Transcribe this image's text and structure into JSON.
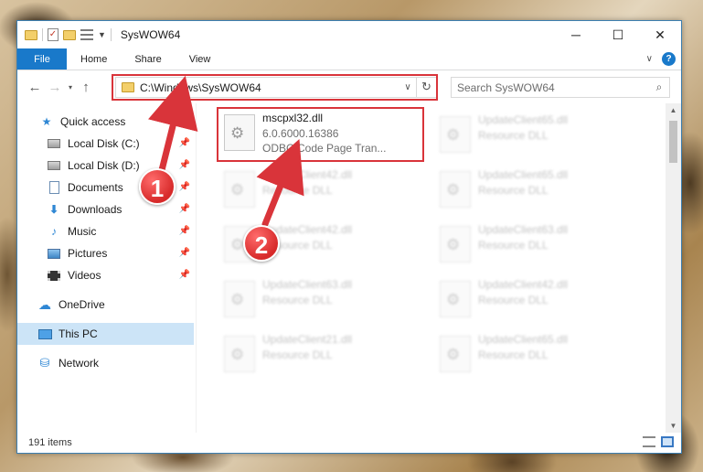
{
  "window": {
    "title": "SysWOW64",
    "controls": {
      "minimize": "─",
      "maximize": "☐",
      "close": "✕"
    }
  },
  "ribbon": {
    "tabs": [
      "File",
      "Home",
      "Share",
      "View"
    ],
    "collapse_glyph": "∨",
    "help_glyph": "?"
  },
  "navbar": {
    "back": "←",
    "forward": "→",
    "recent": "▾",
    "up": "↑",
    "address": "C:\\Windows\\SysWOW64",
    "address_chevron": "∨",
    "refresh": "↻",
    "search_placeholder": "Search SysWOW64",
    "search_glyph": "⌕"
  },
  "sidebar": {
    "items": [
      {
        "label": "Quick access",
        "icon": "star-icon",
        "glyph": "★",
        "pinned": false
      },
      {
        "label": "Local Disk (C:)",
        "icon": "disk-icon",
        "pinned": true
      },
      {
        "label": "Local Disk (D:)",
        "icon": "disk-icon",
        "pinned": true
      },
      {
        "label": "Documents",
        "icon": "documents-icon",
        "pinned": true
      },
      {
        "label": "Downloads",
        "icon": "downloads-icon",
        "glyph": "⬇",
        "pinned": true
      },
      {
        "label": "Music",
        "icon": "music-icon",
        "glyph": "♪",
        "pinned": true
      },
      {
        "label": "Pictures",
        "icon": "pictures-icon",
        "pinned": true
      },
      {
        "label": "Videos",
        "icon": "videos-icon",
        "pinned": true
      },
      {
        "label": "OneDrive",
        "icon": "onedrive-icon",
        "glyph": "☁",
        "pinned": false
      },
      {
        "label": "This PC",
        "icon": "this-pc-icon",
        "pinned": false,
        "selected": true
      },
      {
        "label": "Network",
        "icon": "network-icon",
        "glyph": "⛁",
        "pinned": false
      }
    ],
    "pin_glyph": "📌"
  },
  "files": {
    "highlighted": {
      "name": "mscpxl32.dll",
      "version": "6.0.6000.16386",
      "description": "ODBC Code Page Tran..."
    },
    "left_column": [
      {
        "name": "UpdateClient42.dll",
        "type": "Resource DLL"
      },
      {
        "name": "UpdateClient42.dll",
        "type": "Resource DLL"
      },
      {
        "name": "UpdateClient63.dll",
        "type": "Resource DLL"
      },
      {
        "name": "UpdateClient21.dll",
        "type": "Resource DLL"
      }
    ],
    "right_column": [
      {
        "name": "UpdateClient65.dll",
        "type": "Resource DLL"
      },
      {
        "name": "UpdateClient65.dll",
        "type": "Resource DLL"
      },
      {
        "name": "UpdateClient63.dll",
        "type": "Resource DLL"
      },
      {
        "name": "UpdateClient42.dll",
        "type": "Resource DLL"
      },
      {
        "name": "UpdateClient65.dll",
        "type": "Resource DLL"
      }
    ]
  },
  "status": {
    "item_count": "191 items"
  },
  "annotations": {
    "step1": "1",
    "step2": "2",
    "color": "#d9343a"
  }
}
